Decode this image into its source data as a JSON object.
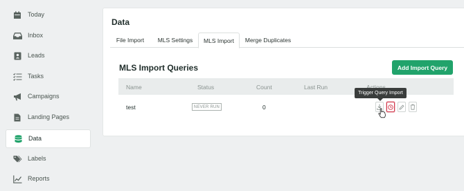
{
  "sidebar": {
    "items": [
      {
        "label": "Today",
        "icon": "calendar-icon"
      },
      {
        "label": "Inbox",
        "icon": "inbox-icon"
      },
      {
        "label": "Leads",
        "icon": "contact-card-icon"
      },
      {
        "label": "Tasks",
        "icon": "checklist-icon"
      },
      {
        "label": "Campaigns",
        "icon": "megaphone-icon"
      },
      {
        "label": "Landing Pages",
        "icon": "document-icon"
      },
      {
        "label": "Data",
        "icon": "database-icon",
        "active": true
      },
      {
        "label": "Labels",
        "icon": "tag-icon"
      },
      {
        "label": "Reports",
        "icon": "chart-line-icon"
      }
    ]
  },
  "main": {
    "title": "Data",
    "tabs": [
      {
        "label": "File Import"
      },
      {
        "label": "MLS Settings"
      },
      {
        "label": "MLS Import",
        "active": true
      },
      {
        "label": "Merge Duplicates"
      }
    ],
    "section_title": "MLS Import Queries",
    "add_button": "Add Import Query",
    "table": {
      "columns": [
        "Name",
        "Status",
        "Count",
        "Last Run",
        "Actions"
      ],
      "rows": [
        {
          "name": "test",
          "status": "NEVER RUN",
          "count": "0",
          "last_run": ""
        }
      ]
    },
    "tooltip": "Trigger Query Import"
  },
  "colors": {
    "accent": "#21a36b",
    "active_icon": "#21a36b",
    "danger": "#d2374b",
    "background": "#eef0f1"
  }
}
